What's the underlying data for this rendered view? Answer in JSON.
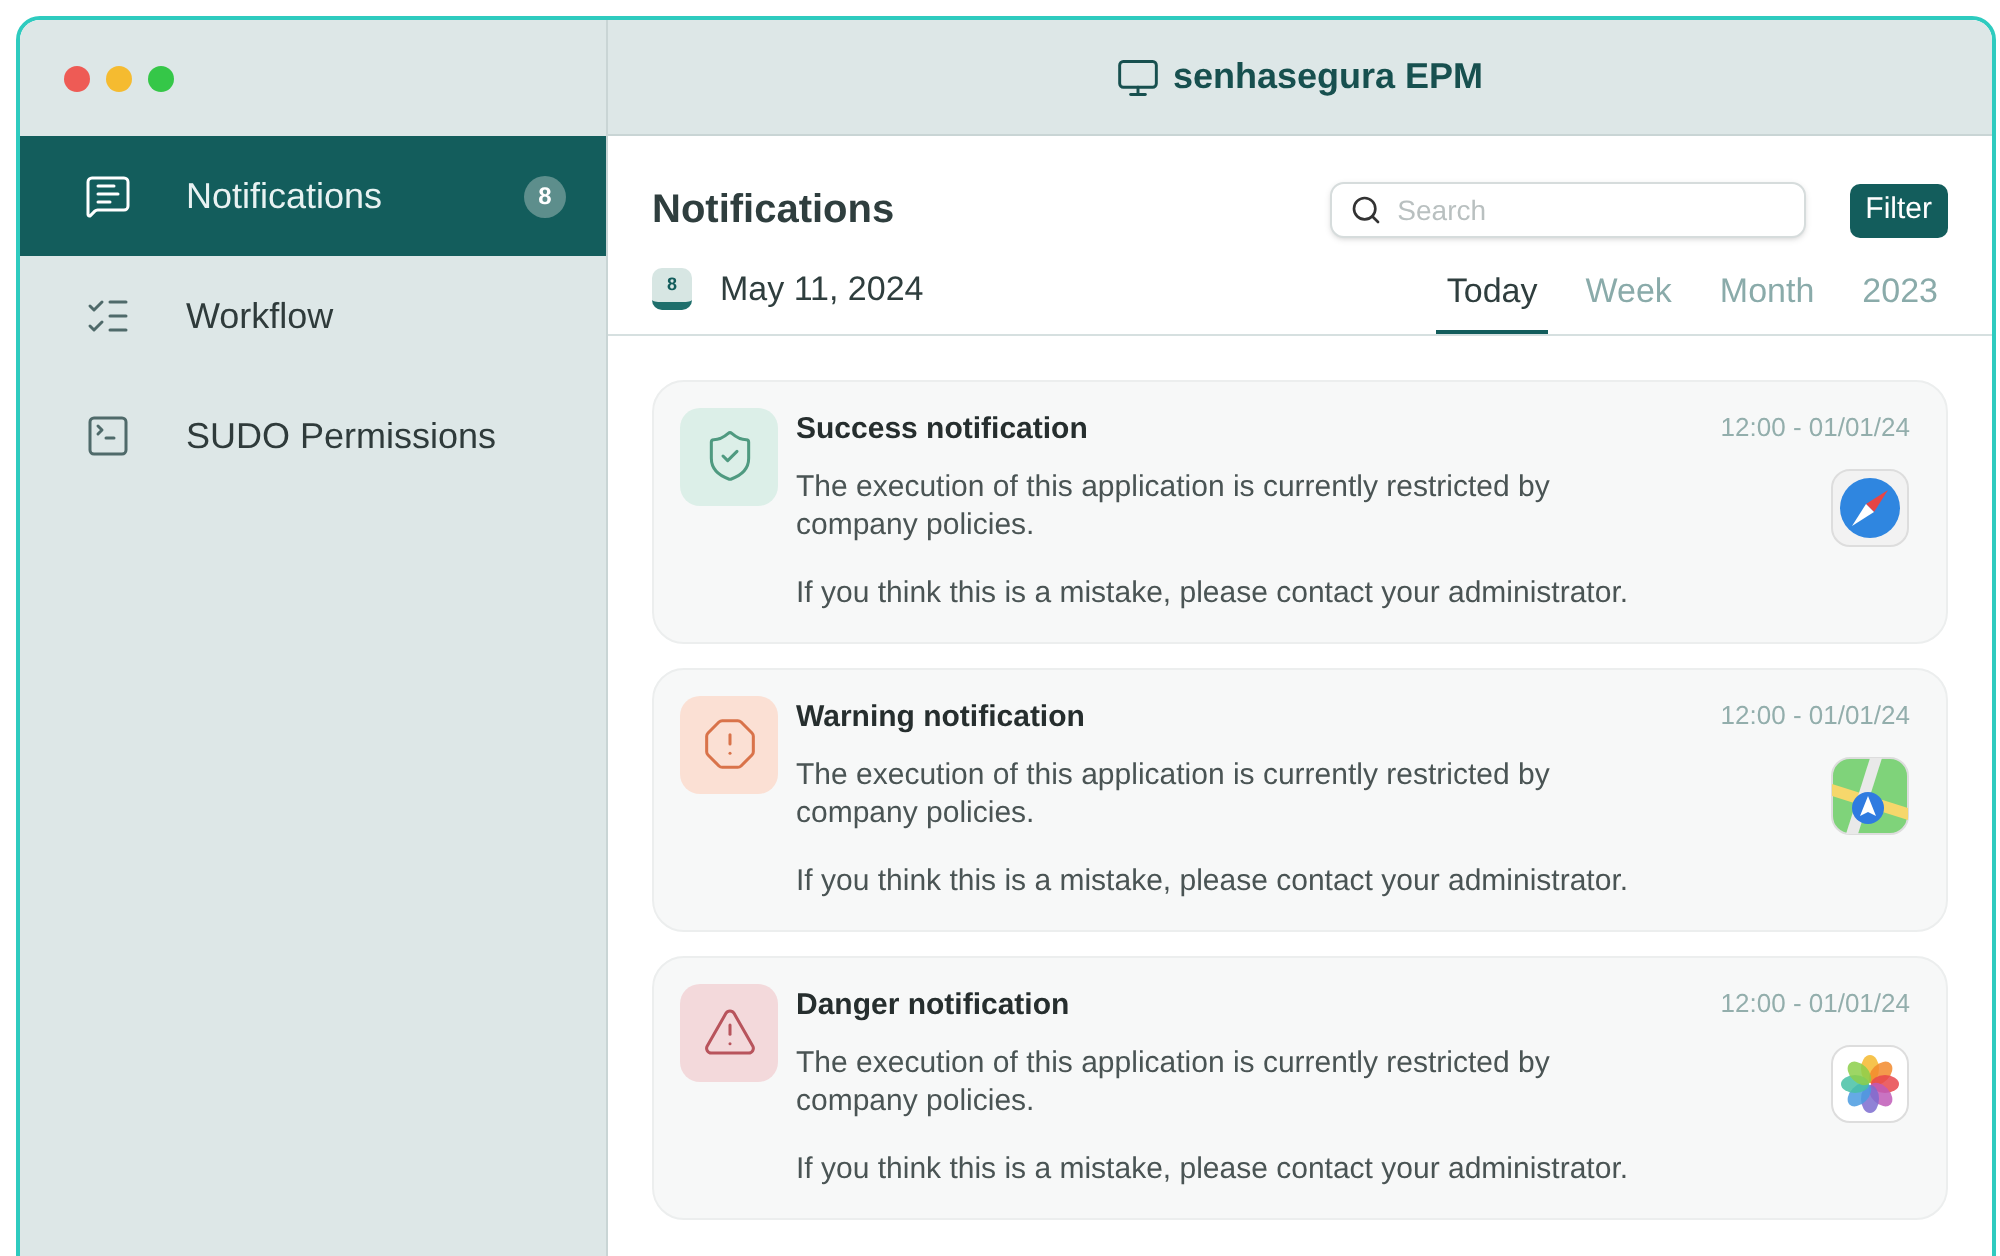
{
  "window": {
    "title": "senhasegura EPM"
  },
  "sidebar": {
    "items": [
      {
        "label": "Notifications",
        "badge": "8",
        "selected": true
      },
      {
        "label": "Workflow",
        "selected": false
      },
      {
        "label": "SUDO Permissions",
        "selected": false
      }
    ]
  },
  "header": {
    "title": "Notifications",
    "search": {
      "placeholder": "Search"
    },
    "filter_button": "Filter"
  },
  "date": {
    "label": "May 11, 2024",
    "calendar_day": "8"
  },
  "tabs": [
    {
      "label": "Today",
      "selected": true
    },
    {
      "label": "Week",
      "selected": false
    },
    {
      "label": "Month",
      "selected": false
    },
    {
      "label": "2023",
      "selected": false
    }
  ],
  "notifications": [
    {
      "kind": "success",
      "title": "Success notification",
      "time": "12:00 - 01/01/24",
      "message": "The execution of this application is currently restricted by company policies.",
      "note": "If you think this is a mistake, please contact your administrator."
    },
    {
      "kind": "warning",
      "title": "Warning notification",
      "time": "12:00 - 01/01/24",
      "message": "The execution of this application is currently restricted by company policies.",
      "note": "If you think this is a mistake, please contact your administrator."
    },
    {
      "kind": "danger",
      "title": "Danger notification",
      "time": "12:00 - 01/01/24",
      "message": "The execution of this application is currently restricted by company policies.",
      "note": "If you think this is a mistake, please contact your administrator."
    }
  ]
}
